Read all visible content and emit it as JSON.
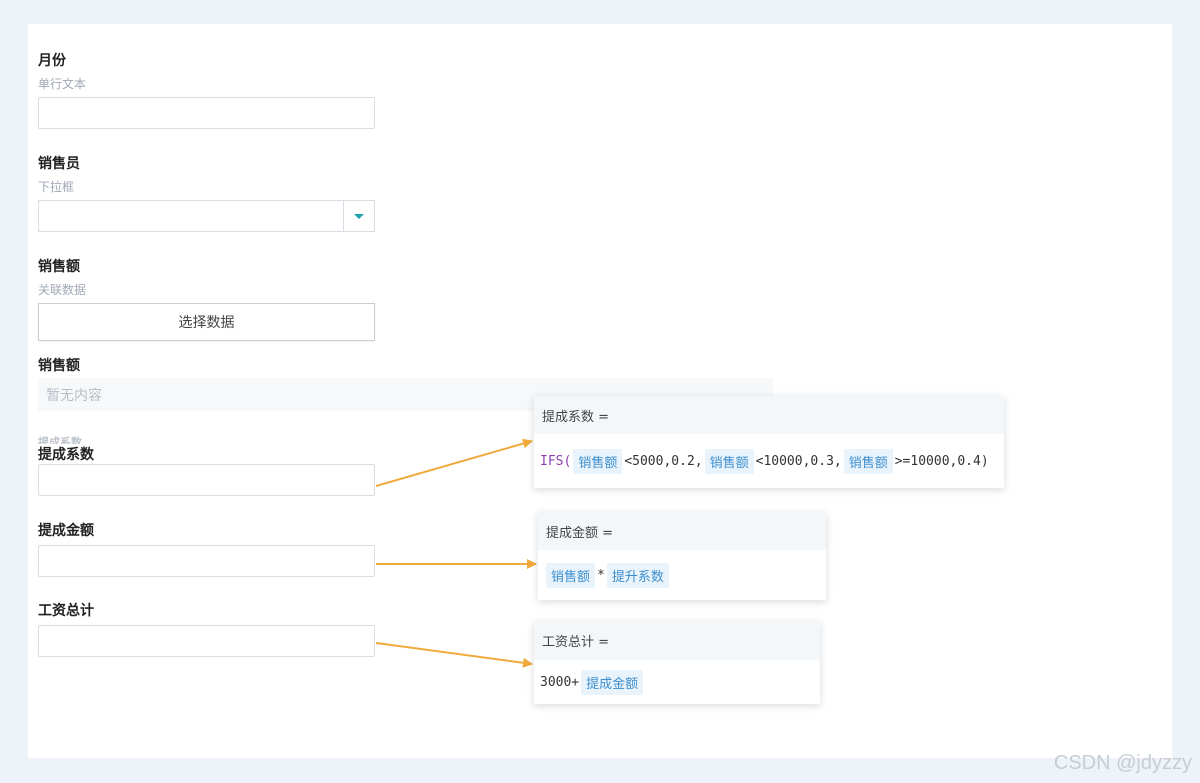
{
  "form": {
    "month": {
      "label": "月份",
      "type": "单行文本"
    },
    "salesperson": {
      "label": "销售员",
      "type": "下拉框"
    },
    "sales_link": {
      "label": "销售额",
      "type": "关联数据",
      "button": "选择数据"
    },
    "sales_display": {
      "label": "销售额",
      "empty": "暂无内容"
    },
    "ghost_label": "提成系数",
    "commission_rate": {
      "label": "提成系数"
    },
    "commission_amount": {
      "label": "提成金额"
    },
    "salary_total": {
      "label": "工资总计"
    }
  },
  "formulas": {
    "rate": {
      "title": "提成系数 =",
      "fn": "IFS(",
      "tokens": [
        "销售额",
        "销售额",
        "销售额"
      ],
      "parts": [
        "<5000,0.2,",
        "<10000,0.3,",
        ">=10000,0.4)"
      ]
    },
    "amount": {
      "title": "提成金额 =",
      "token1": "销售额",
      "op": "*",
      "token2": "提升系数"
    },
    "salary": {
      "title": "工资总计 =",
      "prefix": "3000+",
      "token": "提成金额"
    }
  },
  "colors": {
    "arrow": "#f0aa3c",
    "token_bg": "#e9f3fb",
    "token_text": "#3d8fcf",
    "caret": "#1aa3a8"
  },
  "watermark": "CSDN @jdyzzy"
}
